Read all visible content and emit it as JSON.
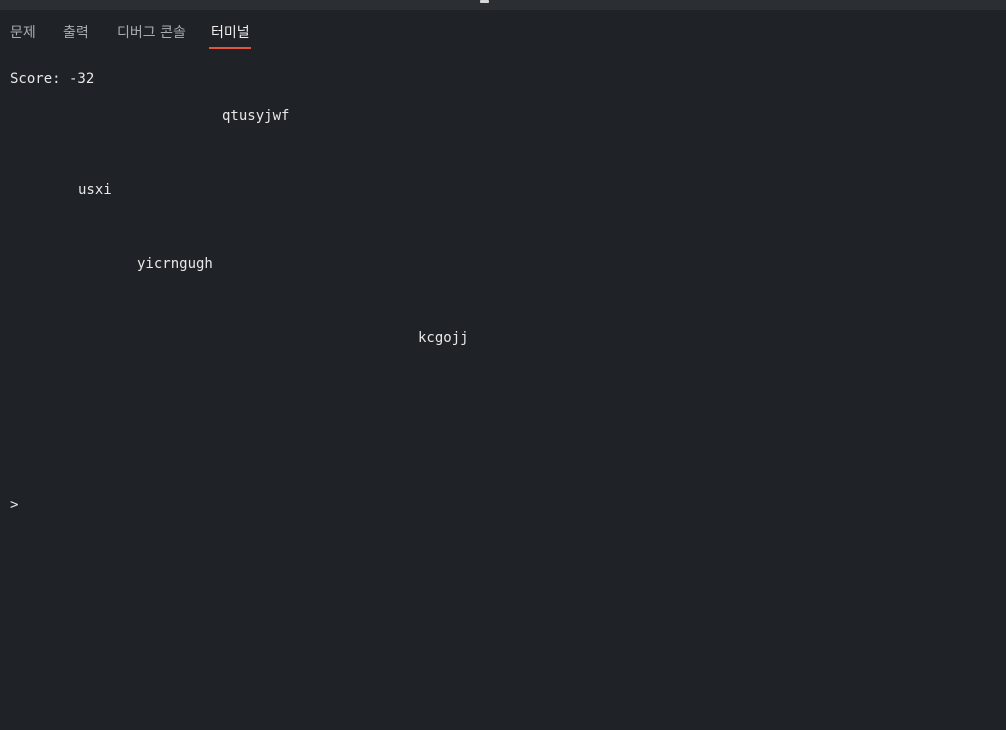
{
  "tabs": [
    {
      "label": "문제",
      "active": false
    },
    {
      "label": "출력",
      "active": false
    },
    {
      "label": "디버그 콘솔",
      "active": false
    },
    {
      "label": "터미널",
      "active": true
    }
  ],
  "terminal": {
    "score_line": "Score: -32",
    "words": [
      "qtusyjwf",
      "usxi",
      "yicrngugh",
      "kcgojj"
    ],
    "prompt": ">"
  },
  "colors": {
    "background": "#1f2226",
    "active_tab_underline": "#e0553c",
    "text": "#e8e8e8"
  }
}
